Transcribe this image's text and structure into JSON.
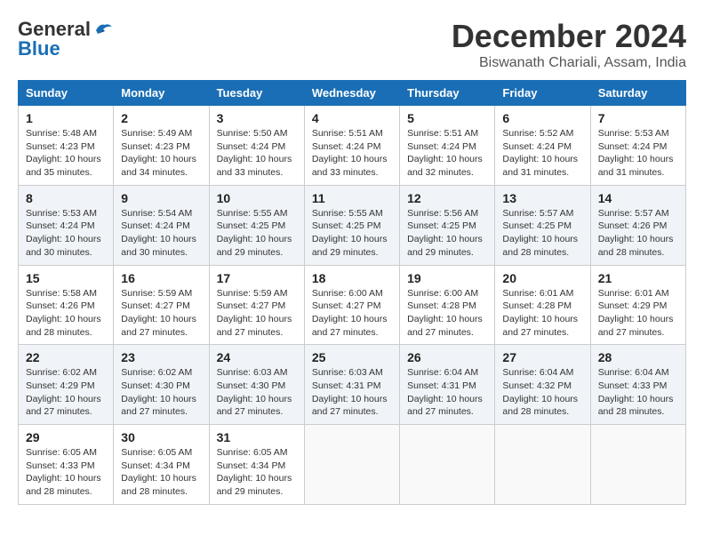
{
  "logo": {
    "line1": "General",
    "line2": "Blue"
  },
  "title": "December 2024",
  "location": "Biswanath Chariali, Assam, India",
  "weekdays": [
    "Sunday",
    "Monday",
    "Tuesday",
    "Wednesday",
    "Thursday",
    "Friday",
    "Saturday"
  ],
  "weeks": [
    [
      {
        "day": "1",
        "info": "Sunrise: 5:48 AM\nSunset: 4:23 PM\nDaylight: 10 hours\nand 35 minutes."
      },
      {
        "day": "2",
        "info": "Sunrise: 5:49 AM\nSunset: 4:23 PM\nDaylight: 10 hours\nand 34 minutes."
      },
      {
        "day": "3",
        "info": "Sunrise: 5:50 AM\nSunset: 4:24 PM\nDaylight: 10 hours\nand 33 minutes."
      },
      {
        "day": "4",
        "info": "Sunrise: 5:51 AM\nSunset: 4:24 PM\nDaylight: 10 hours\nand 33 minutes."
      },
      {
        "day": "5",
        "info": "Sunrise: 5:51 AM\nSunset: 4:24 PM\nDaylight: 10 hours\nand 32 minutes."
      },
      {
        "day": "6",
        "info": "Sunrise: 5:52 AM\nSunset: 4:24 PM\nDaylight: 10 hours\nand 31 minutes."
      },
      {
        "day": "7",
        "info": "Sunrise: 5:53 AM\nSunset: 4:24 PM\nDaylight: 10 hours\nand 31 minutes."
      }
    ],
    [
      {
        "day": "8",
        "info": "Sunrise: 5:53 AM\nSunset: 4:24 PM\nDaylight: 10 hours\nand 30 minutes."
      },
      {
        "day": "9",
        "info": "Sunrise: 5:54 AM\nSunset: 4:24 PM\nDaylight: 10 hours\nand 30 minutes."
      },
      {
        "day": "10",
        "info": "Sunrise: 5:55 AM\nSunset: 4:25 PM\nDaylight: 10 hours\nand 29 minutes."
      },
      {
        "day": "11",
        "info": "Sunrise: 5:55 AM\nSunset: 4:25 PM\nDaylight: 10 hours\nand 29 minutes."
      },
      {
        "day": "12",
        "info": "Sunrise: 5:56 AM\nSunset: 4:25 PM\nDaylight: 10 hours\nand 29 minutes."
      },
      {
        "day": "13",
        "info": "Sunrise: 5:57 AM\nSunset: 4:25 PM\nDaylight: 10 hours\nand 28 minutes."
      },
      {
        "day": "14",
        "info": "Sunrise: 5:57 AM\nSunset: 4:26 PM\nDaylight: 10 hours\nand 28 minutes."
      }
    ],
    [
      {
        "day": "15",
        "info": "Sunrise: 5:58 AM\nSunset: 4:26 PM\nDaylight: 10 hours\nand 28 minutes."
      },
      {
        "day": "16",
        "info": "Sunrise: 5:59 AM\nSunset: 4:27 PM\nDaylight: 10 hours\nand 27 minutes."
      },
      {
        "day": "17",
        "info": "Sunrise: 5:59 AM\nSunset: 4:27 PM\nDaylight: 10 hours\nand 27 minutes."
      },
      {
        "day": "18",
        "info": "Sunrise: 6:00 AM\nSunset: 4:27 PM\nDaylight: 10 hours\nand 27 minutes."
      },
      {
        "day": "19",
        "info": "Sunrise: 6:00 AM\nSunset: 4:28 PM\nDaylight: 10 hours\nand 27 minutes."
      },
      {
        "day": "20",
        "info": "Sunrise: 6:01 AM\nSunset: 4:28 PM\nDaylight: 10 hours\nand 27 minutes."
      },
      {
        "day": "21",
        "info": "Sunrise: 6:01 AM\nSunset: 4:29 PM\nDaylight: 10 hours\nand 27 minutes."
      }
    ],
    [
      {
        "day": "22",
        "info": "Sunrise: 6:02 AM\nSunset: 4:29 PM\nDaylight: 10 hours\nand 27 minutes."
      },
      {
        "day": "23",
        "info": "Sunrise: 6:02 AM\nSunset: 4:30 PM\nDaylight: 10 hours\nand 27 minutes."
      },
      {
        "day": "24",
        "info": "Sunrise: 6:03 AM\nSunset: 4:30 PM\nDaylight: 10 hours\nand 27 minutes."
      },
      {
        "day": "25",
        "info": "Sunrise: 6:03 AM\nSunset: 4:31 PM\nDaylight: 10 hours\nand 27 minutes."
      },
      {
        "day": "26",
        "info": "Sunrise: 6:04 AM\nSunset: 4:31 PM\nDaylight: 10 hours\nand 27 minutes."
      },
      {
        "day": "27",
        "info": "Sunrise: 6:04 AM\nSunset: 4:32 PM\nDaylight: 10 hours\nand 28 minutes."
      },
      {
        "day": "28",
        "info": "Sunrise: 6:04 AM\nSunset: 4:33 PM\nDaylight: 10 hours\nand 28 minutes."
      }
    ],
    [
      {
        "day": "29",
        "info": "Sunrise: 6:05 AM\nSunset: 4:33 PM\nDaylight: 10 hours\nand 28 minutes."
      },
      {
        "day": "30",
        "info": "Sunrise: 6:05 AM\nSunset: 4:34 PM\nDaylight: 10 hours\nand 28 minutes."
      },
      {
        "day": "31",
        "info": "Sunrise: 6:05 AM\nSunset: 4:34 PM\nDaylight: 10 hours\nand 29 minutes."
      },
      {
        "day": "",
        "info": ""
      },
      {
        "day": "",
        "info": ""
      },
      {
        "day": "",
        "info": ""
      },
      {
        "day": "",
        "info": ""
      }
    ]
  ]
}
